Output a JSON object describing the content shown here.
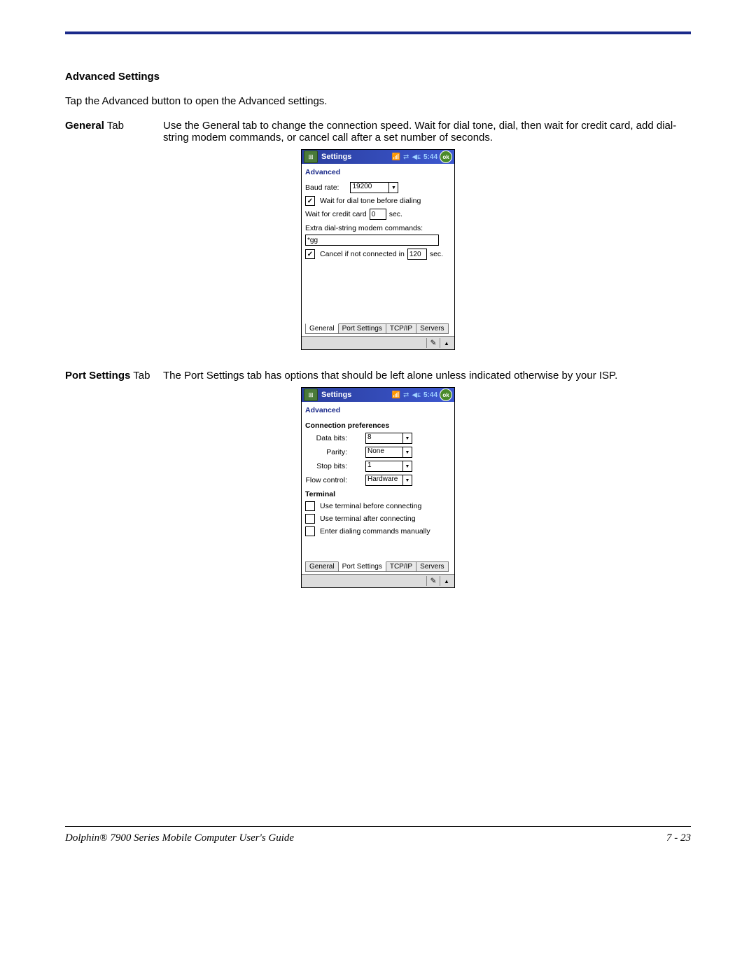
{
  "section_title": "Advanced Settings",
  "intro_text": "Tap the Advanced button to open the Advanced settings.",
  "general_tab_label": "General",
  "general_tab_suffix": " Tab",
  "general_tab_desc": "Use the General tab to change the connection speed. Wait for dial tone, dial, then wait for credit card, add dial-string modem commands, or cancel call after a set number of seconds.",
  "port_settings_tab_label": "Port Settings",
  "port_settings_tab_suffix": " Tab",
  "port_settings_desc": "The Port Settings tab has options that should be left alone unless indicated otherwise by your ISP.",
  "footer_left": "Dolphin® 7900 Series Mobile Computer User's Guide",
  "footer_right": "7 - 23",
  "general_screen": {
    "titlebar": "Settings",
    "time": "5:44",
    "ok": "ok",
    "heading": "Advanced",
    "baud_label": "Baud rate:",
    "baud_value": "19200",
    "wait_dial_checked": true,
    "wait_dial_label": "Wait for dial tone before dialing",
    "wait_credit_label": "Wait for credit card",
    "wait_credit_value": "0",
    "sec": "sec.",
    "extra_label": "Extra dial-string modem commands:",
    "extra_value": "*gg",
    "cancel_checked": true,
    "cancel_label": "Cancel if not connected in",
    "cancel_value": "120",
    "tabs": [
      "General",
      "Port Settings",
      "TCP/IP",
      "Servers"
    ],
    "active_tab_index": 0
  },
  "port_screen": {
    "titlebar": "Settings",
    "time": "5:44",
    "ok": "ok",
    "heading": "Advanced",
    "conn_pref": "Connection preferences",
    "data_bits_label": "Data bits:",
    "data_bits_value": "8",
    "parity_label": "Parity:",
    "parity_value": "None",
    "stop_bits_label": "Stop bits:",
    "stop_bits_value": "1",
    "flow_label": "Flow control:",
    "flow_value": "Hardware",
    "terminal": "Terminal",
    "term_before_checked": false,
    "term_before_label": "Use terminal before connecting",
    "term_after_checked": false,
    "term_after_label": "Use terminal after connecting",
    "term_manual_checked": false,
    "term_manual_label": "Enter dialing commands manually",
    "tabs": [
      "General",
      "Port Settings",
      "TCP/IP",
      "Servers"
    ],
    "active_tab_index": 1
  }
}
